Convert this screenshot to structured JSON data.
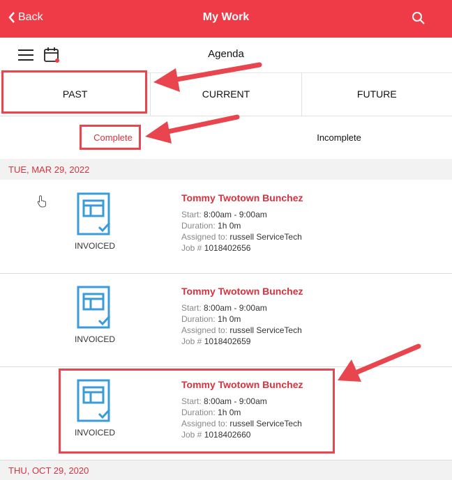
{
  "header": {
    "back_label": "Back",
    "title": "My Work"
  },
  "subheader": {
    "title": "Agenda"
  },
  "tabs": [
    {
      "label": "PAST"
    },
    {
      "label": "CURRENT"
    },
    {
      "label": "FUTURE"
    }
  ],
  "subtabs": [
    {
      "label": "Complete"
    },
    {
      "label": "Incomplete"
    }
  ],
  "groups": [
    {
      "date": "TUE, MAR 29, 2022"
    },
    {
      "date": "THU, OCT 29, 2020"
    }
  ],
  "jobs": [
    {
      "status": "INVOICED",
      "name": "Tommy Twotown Bunchez",
      "start_label": "Start:",
      "start": "8:00am - 9:00am",
      "duration_label": "Duration:",
      "duration": "1h 0m",
      "assigned_label": "Assigned to:",
      "assigned": "russell ServiceTech",
      "job_label": "Job #",
      "job_no": "1018402656"
    },
    {
      "status": "INVOICED",
      "name": "Tommy Twotown Bunchez",
      "start_label": "Start:",
      "start": "8:00am - 9:00am",
      "duration_label": "Duration:",
      "duration": "1h 0m",
      "assigned_label": "Assigned to:",
      "assigned": "russell ServiceTech",
      "job_label": "Job #",
      "job_no": "1018402659"
    },
    {
      "status": "INVOICED",
      "name": "Tommy Twotown Bunchez",
      "start_label": "Start:",
      "start": "8:00am - 9:00am",
      "duration_label": "Duration:",
      "duration": "1h 0m",
      "assigned_label": "Assigned to:",
      "assigned": "russell ServiceTech",
      "job_label": "Job #",
      "job_no": "1018402660"
    }
  ],
  "colors": {
    "brand": "#ef3b47",
    "accent_text": "#d9313e",
    "doc_icon": "#3a9bd9",
    "annotation": "#e8454f"
  },
  "icons": {
    "back": "chevron-left-icon",
    "search": "search-icon",
    "menu": "hamburger-icon",
    "calendar": "calendar-icon",
    "document": "invoice-document-icon"
  }
}
